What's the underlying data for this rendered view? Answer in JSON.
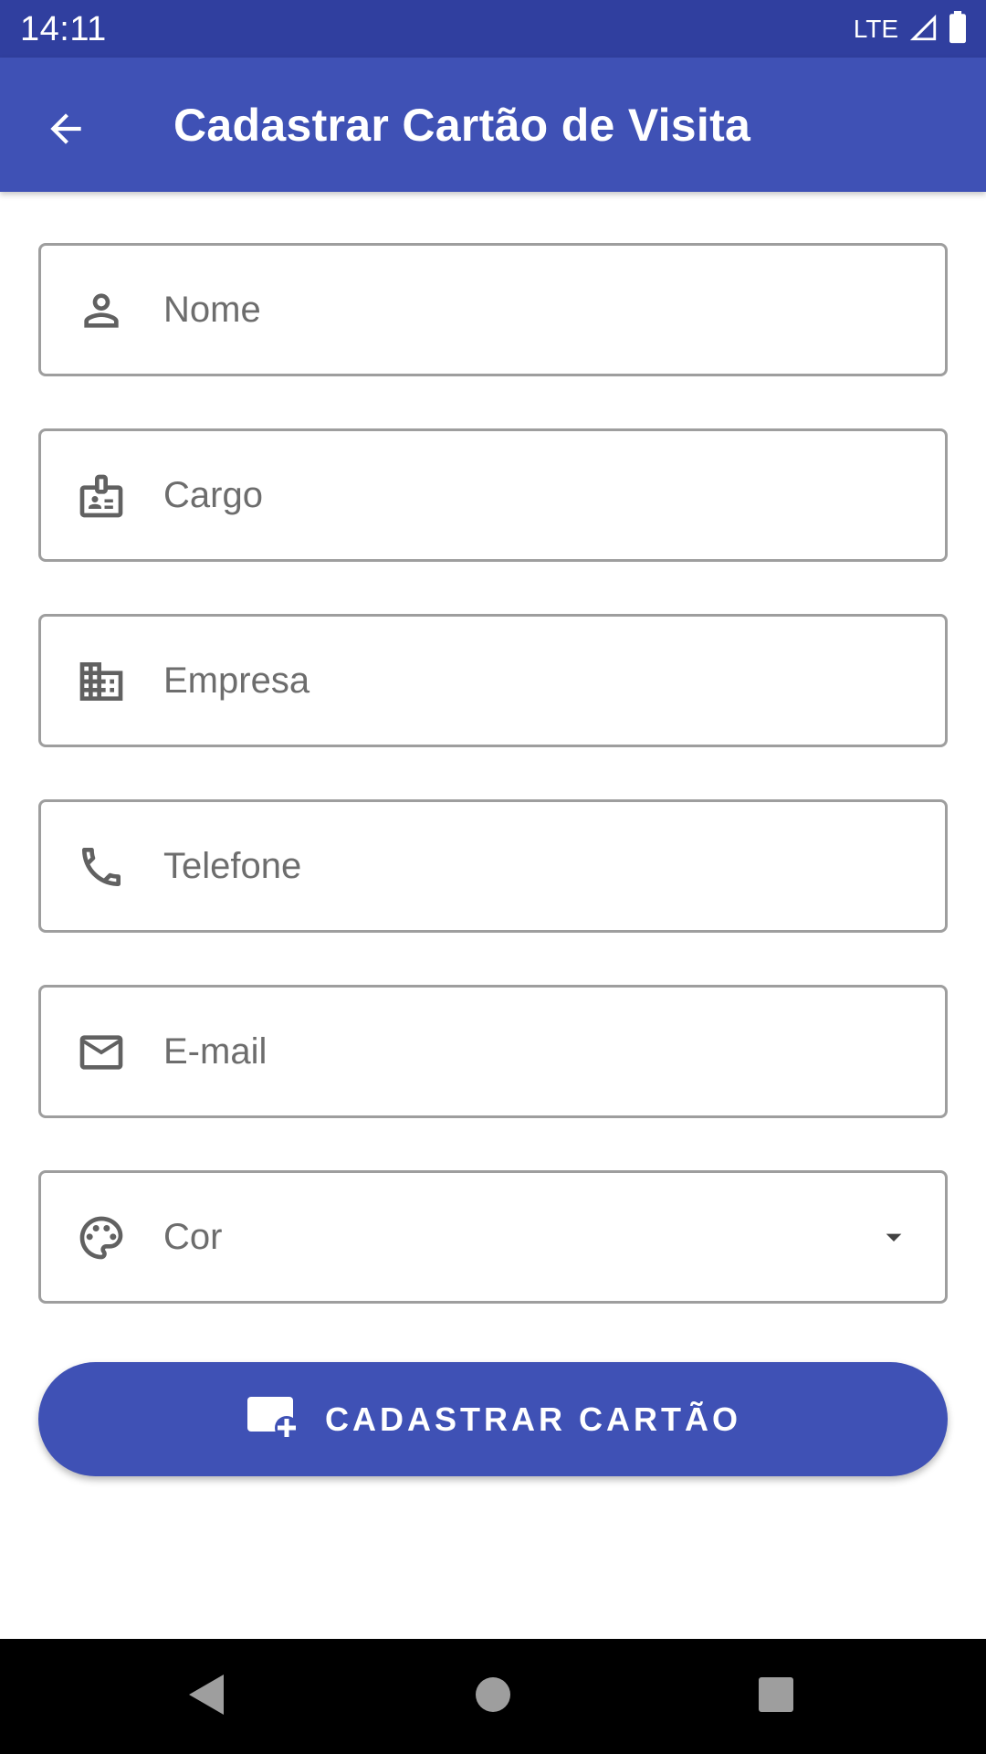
{
  "status_bar": {
    "time": "14:11",
    "network": "LTE"
  },
  "app_bar": {
    "title": "Cadastrar Cartão de Visita",
    "back_icon": "arrow-back-icon"
  },
  "form": {
    "fields": [
      {
        "key": "nome",
        "placeholder": "Nome",
        "value": "",
        "icon": "person-icon"
      },
      {
        "key": "cargo",
        "placeholder": "Cargo",
        "value": "",
        "icon": "badge-icon"
      },
      {
        "key": "empresa",
        "placeholder": "Empresa",
        "value": "",
        "icon": "business-icon"
      },
      {
        "key": "telefone",
        "placeholder": "Telefone",
        "value": "",
        "icon": "phone-icon"
      },
      {
        "key": "email",
        "placeholder": "E-mail",
        "value": "",
        "icon": "email-icon"
      }
    ],
    "color_select": {
      "label": "Cor",
      "icon": "palette-icon",
      "dropdown_icon": "arrow-drop-down-icon"
    }
  },
  "submit_button": {
    "label": "CADASTRAR CARTÃO",
    "icon": "add-card-icon"
  },
  "nav_bar": {
    "back_icon": "nav-back-icon",
    "home_icon": "nav-home-icon",
    "recents_icon": "nav-recents-icon"
  },
  "colors": {
    "status_bar": "#303f9f",
    "primary": "#3f51b5",
    "field_border": "#9e9e9e",
    "icon_gray": "#616161",
    "placeholder": "#6d6d6d",
    "nav_bar": "#000000"
  }
}
